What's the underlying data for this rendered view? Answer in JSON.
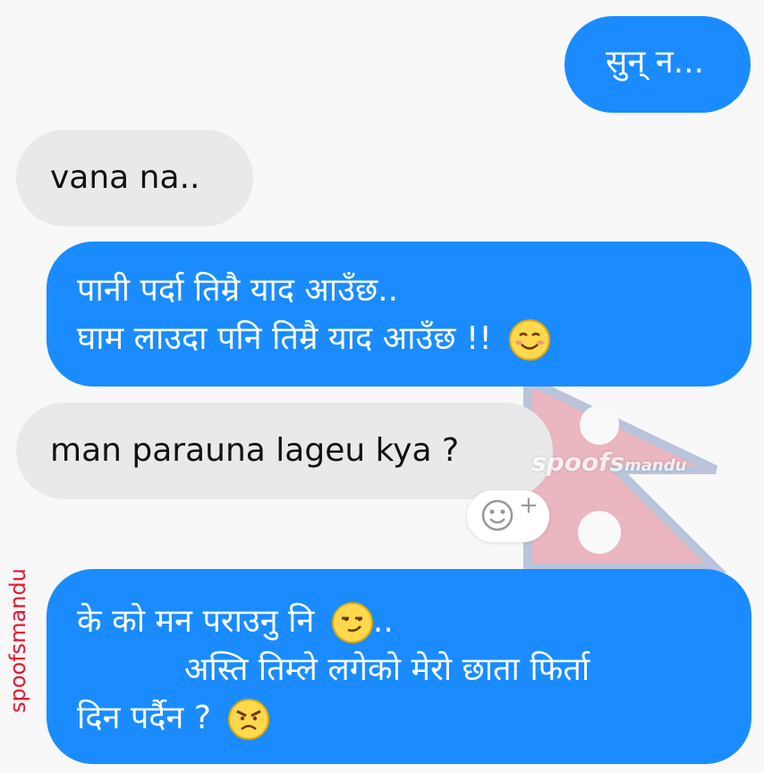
{
  "messages": [
    {
      "id": "b1",
      "side": "outgoing",
      "lines": [
        "सुन् न..."
      ]
    },
    {
      "id": "b2",
      "side": "incoming",
      "lines": [
        "vana na.."
      ]
    },
    {
      "id": "b3",
      "side": "outgoing",
      "lines": [
        "पानी पर्दा तिम्रै याद आउँछ..",
        "घाम लाउदा पनि तिम्रै याद आउँछ !!"
      ],
      "emoji": "smiling-face-icon"
    },
    {
      "id": "b4",
      "side": "incoming",
      "lines": [
        "man parauna lageu kya ?"
      ]
    },
    {
      "id": "b5",
      "side": "outgoing",
      "lines": [
        "के को मन पराउनु नि",
        "..",
        "अस्ति तिम्ले लगेको मेरो छाता फिर्ता",
        "दिन पर्दैन ?"
      ],
      "emojis": [
        "smirking-face-icon",
        "angry-face-icon"
      ]
    }
  ],
  "reaction": {
    "plus": "+",
    "icon": "add-reaction-icon"
  },
  "watermark": {
    "big": "spoofs",
    "small": "mandu",
    "side": "spoofsmandu"
  },
  "colors": {
    "outgoing": "#1a8cff",
    "incoming": "#e9e9e9",
    "watermark": "#e8152e"
  }
}
